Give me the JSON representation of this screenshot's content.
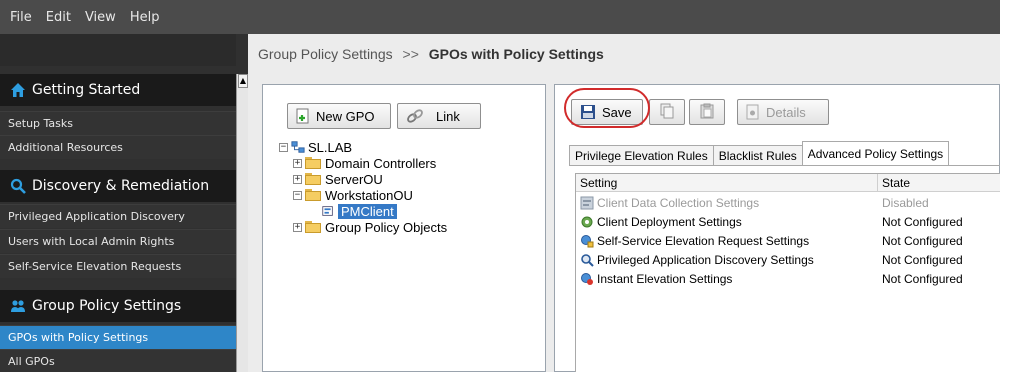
{
  "menubar": {
    "items": [
      "File",
      "Edit",
      "View",
      "Help"
    ]
  },
  "sidebar": {
    "sections": [
      {
        "title": "Getting Started",
        "icon": "home-icon",
        "items": [
          "Setup Tasks",
          "Additional Resources"
        ]
      },
      {
        "title": "Discovery & Remediation",
        "icon": "search-icon",
        "items": [
          "Privileged Application Discovery",
          "Users with Local Admin Rights",
          "Self-Service Elevation Requests"
        ]
      },
      {
        "title": "Group Policy Settings",
        "icon": "users-icon",
        "items": [
          "GPOs with Policy Settings",
          "All GPOs"
        ]
      }
    ],
    "active_item": "GPOs with Policy Settings"
  },
  "breadcrumb": {
    "parent": "Group Policy Settings",
    "separator": ">>",
    "current": "GPOs with Policy Settings"
  },
  "toolbar_left": {
    "new_gpo": "New GPO",
    "link": "Link"
  },
  "tree": {
    "root": "SL.LAB",
    "nodes": [
      "Domain Controllers",
      "ServerOU",
      "WorkstationOU",
      "PMClient",
      "Group Policy Objects"
    ],
    "selected": "PMClient"
  },
  "toolbar_right": {
    "save": "Save",
    "details": "Details"
  },
  "tabs": [
    "Privilege Elevation Rules",
    "Blacklist Rules",
    "Advanced Policy Settings"
  ],
  "active_tab": "Advanced Policy Settings",
  "table": {
    "columns": [
      "Setting",
      "State"
    ],
    "rows": [
      {
        "setting": "Client Data Collection Settings",
        "state": "Disabled"
      },
      {
        "setting": "Client Deployment Settings",
        "state": "Not Configured"
      },
      {
        "setting": "Self-Service Elevation Request Settings",
        "state": "Not Configured"
      },
      {
        "setting": "Privileged Application Discovery Settings",
        "state": "Not Configured"
      },
      {
        "setting": "Instant Elevation Settings",
        "state": "Not Configured"
      }
    ]
  },
  "colors": {
    "active_sidebar": "#2e86c8",
    "highlight_circle": "#d12b2b",
    "tree_selected": "#3579c6"
  }
}
